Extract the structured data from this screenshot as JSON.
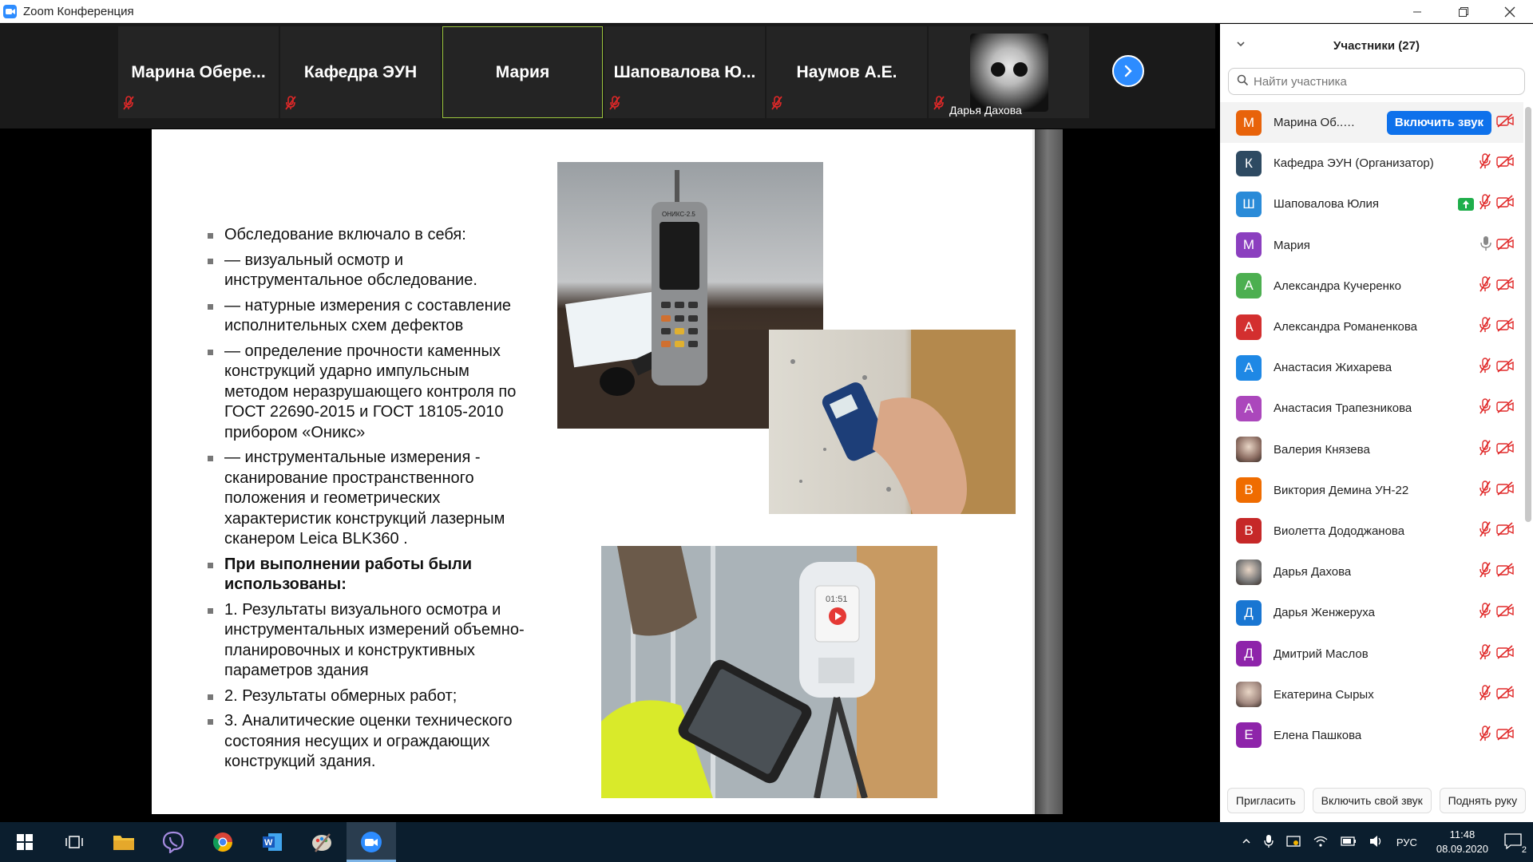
{
  "window": {
    "title": "Zoom Конференция",
    "minimize_icon": "minimize-icon",
    "maximize_icon": "restore-icon",
    "close_icon": "close-icon"
  },
  "video_strip": {
    "tiles": [
      {
        "name": "Марина  Обере...",
        "mic_muted": true
      },
      {
        "name": "Кафедра ЭУН",
        "mic_muted": true
      },
      {
        "name": "Мария",
        "mic_muted": false,
        "active_speaker": true
      },
      {
        "name": "Шаповалова  Ю...",
        "mic_muted": true
      },
      {
        "name": "Наумов А.Е.",
        "mic_muted": true
      },
      {
        "name": "Дарья Дахова",
        "mic_muted": true,
        "has_picture": true
      }
    ],
    "next_page_icon": "chevron-right-icon"
  },
  "slide": {
    "bullets": [
      {
        "text": "Обследование включало в себя:",
        "bold": false
      },
      {
        "text": "— визуальный осмотр и инструментальное обследование.",
        "bold": false
      },
      {
        "text": "— натурные измерения  с составление исполнительных схем дефектов",
        "bold": false
      },
      {
        "text": "— определение прочности каменных конструкций ударно импульсным методом неразрушающего контроля по ГОСТ 22690-2015 и ГОСТ 18105-2010 прибором «Оникс»",
        "bold": false
      },
      {
        "text": "— инструментальные  измерения  - сканирование пространственного положения и геометрических характеристик конструкций лазерным сканером Leica BLK360 .",
        "bold": false
      },
      {
        "text": "При выполнении работы были использованы:",
        "bold": true
      },
      {
        "text": "1. Результаты визуального осмотра и инструментальных измерений объемно-планировочных и конструктивных параметров здания",
        "bold": false
      },
      {
        "text": "2. Результаты обмерных работ;",
        "bold": false
      },
      {
        "text": "3. Аналитические  оценки технического состояния несущих и ограждающих конструкций здания.",
        "bold": false
      }
    ],
    "photo1_text": "ОНИКС-2.5",
    "photo3_text": "01:51"
  },
  "participants_panel": {
    "title": "Участники (27)",
    "search_placeholder": "Найти участника",
    "unmute_label": "Включить звук",
    "participants": [
      {
        "initial": "М",
        "name": "Марина Об...  (Я)",
        "color": "#e8630a",
        "me": true
      },
      {
        "initial": "К",
        "name": "Кафедра ЭУН (Организатор)",
        "color": "#2e4a62"
      },
      {
        "initial": "Ш",
        "name": "Шаповалова Юлия",
        "color": "#2a8bd8",
        "sharing": true
      },
      {
        "initial": "М",
        "name": "Мария",
        "color": "#8b3fbf",
        "mic_on": true
      },
      {
        "initial": "А",
        "name": "Александра Кучеренко",
        "color": "#4caf50"
      },
      {
        "initial": "А",
        "name": "Александра Романенкова",
        "color": "#d32f2f"
      },
      {
        "initial": "А",
        "name": "Анастасия Жихарева",
        "color": "#1e88e5"
      },
      {
        "initial": "А",
        "name": "Анастасия Трапезникова",
        "color": "#ab47bc"
      },
      {
        "initial": "",
        "name": "Валерия Князева",
        "color": "#8d6e63",
        "photo": true
      },
      {
        "initial": "В",
        "name": "Виктория Демина УН-22",
        "color": "#ef6c00"
      },
      {
        "initial": "В",
        "name": "Виолетта Дододжанова",
        "color": "#c62828"
      },
      {
        "initial": "",
        "name": "Дарья Дахова",
        "color": "#777777",
        "photo": true
      },
      {
        "initial": "Д",
        "name": "Дарья Женжеруха",
        "color": "#1976d2"
      },
      {
        "initial": "Д",
        "name": "Дмитрий Маслов",
        "color": "#8e24aa"
      },
      {
        "initial": "",
        "name": "Екатерина Сырых",
        "color": "#a1887f",
        "photo": true
      },
      {
        "initial": "Е",
        "name": "Елена Пашкова",
        "color": "#8e24aa"
      }
    ],
    "footer": {
      "invite": "Пригласить",
      "unmute_me": "Включить свой звук",
      "raise_hand": "Поднять руку"
    }
  },
  "taskbar": {
    "apps": [
      {
        "icon": "windows-start-icon"
      },
      {
        "icon": "task-view-icon"
      },
      {
        "icon": "file-explorer-icon"
      },
      {
        "icon": "viber-icon"
      },
      {
        "icon": "chrome-icon"
      },
      {
        "icon": "word-icon"
      },
      {
        "icon": "paint-icon"
      },
      {
        "icon": "zoom-icon",
        "active": true
      }
    ],
    "language": "РУС",
    "time": "11:48",
    "date": "08.09.2020",
    "notification_count": "2"
  },
  "colors": {
    "zoom_blue": "#2d8cff",
    "unmute_blue": "#0e71eb",
    "muted_red": "#e02828",
    "active_speaker": "#9bc53d",
    "taskbar": "#0b1e2e"
  }
}
